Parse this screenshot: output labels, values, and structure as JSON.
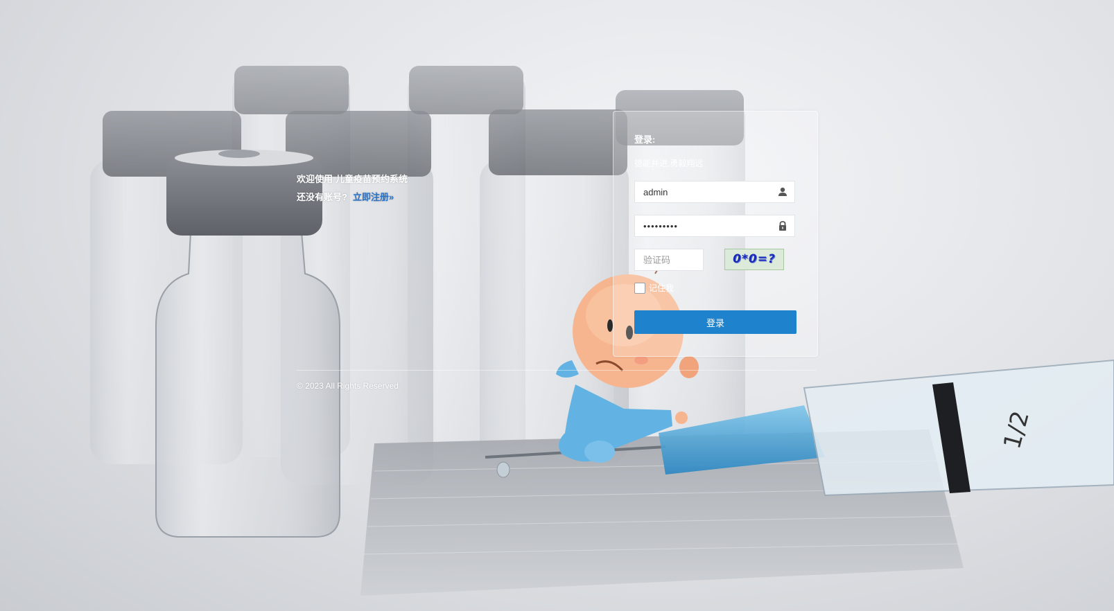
{
  "welcome": {
    "greeting": "欢迎使用",
    "system_name": "儿童疫苗预约系统",
    "no_account_prompt": "还没有账号?",
    "register_link": "立即注册»"
  },
  "login": {
    "title": "登录:",
    "subtitle": "德能并进,勇毅翔远",
    "username_value": "admin",
    "password_value": "•••••••••",
    "captcha_placeholder": "验证码",
    "captcha_text": "0*0=?",
    "remember_label": "记住我",
    "remember_checked": false,
    "submit_label": "登录"
  },
  "footer": {
    "copyright": "© 2023 All Rights Reserved"
  },
  "colors": {
    "primary_button": "#1e82cc",
    "link": "#2a73c9",
    "captcha_text": "#1a2bb5",
    "captcha_bg": "#dcebd9"
  },
  "icons": {
    "username": "user-icon",
    "password": "lock-icon"
  }
}
